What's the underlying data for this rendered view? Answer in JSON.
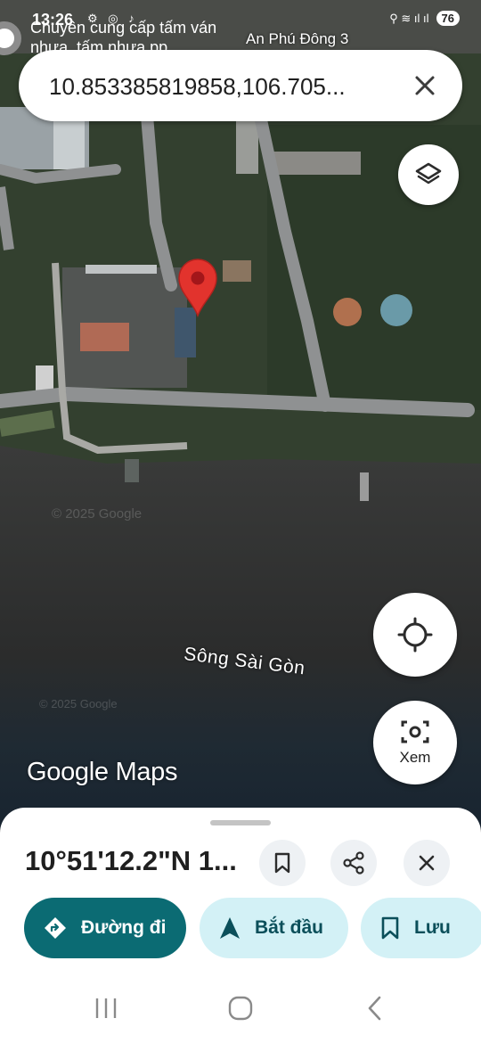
{
  "status_bar": {
    "time": "13:26",
    "battery": "76",
    "left_icons": "⚙ ◎ ♪",
    "right_icons": "⚲ ≋ ıl ıl"
  },
  "notification": {
    "text": "Chuyên cung cấp tấm ván nhựa, tấm nhựa pp"
  },
  "search": {
    "value": "10.853385819858,106.705..."
  },
  "map": {
    "area_label": "An Phú Đông 3",
    "river_label": "Sông Sài Gòn",
    "watermark": "© 2025 Google",
    "brand": "Google Maps",
    "pin_color": "#e2332d"
  },
  "buttons": {
    "lens_label": "Xem"
  },
  "sheet": {
    "title": "10°51'12.2\"N 1...",
    "actions": {
      "directions": "Đường đi",
      "start": "Bắt đầu",
      "save": "Lưu"
    }
  },
  "colors": {
    "primary": "#0b6b73",
    "tonal": "#d3f1f6"
  }
}
